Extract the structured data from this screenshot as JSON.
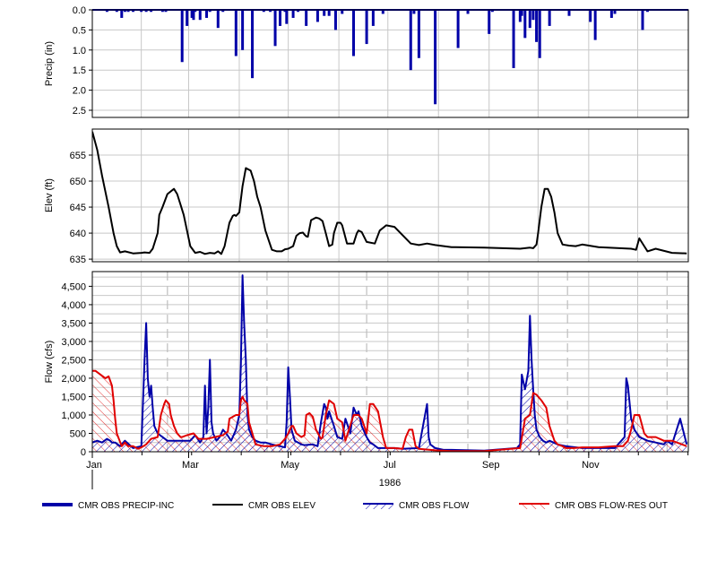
{
  "colors": {
    "precip": "#0000A8",
    "elev": "#000000",
    "flow": "#0000A8",
    "res_out": "#E00000",
    "grid": "#C8C8C8",
    "vgrid_dash": "#BEBEBE",
    "frame": "#000000"
  },
  "chart_data": [
    {
      "type": "bar",
      "panel": "precip",
      "ylabel": "Precip (in)",
      "ylim": [
        0,
        2.5
      ],
      "inverted_y": true,
      "yticks": [
        "0.0",
        "0.5",
        "1.0",
        "1.5",
        "2.0",
        "2.5"
      ],
      "grid": true,
      "series": [
        {
          "name": "CMR OBS PRECIP-INC",
          "x_day": [
            9,
            15,
            18,
            20,
            22,
            25,
            30,
            33,
            36,
            43,
            45,
            55,
            58,
            61,
            62,
            63,
            66,
            70,
            72,
            77,
            80,
            88,
            92,
            98,
            105,
            109,
            112,
            115,
            118,
            119,
            123,
            126,
            131,
            138,
            142,
            145,
            149,
            153,
            160,
            168,
            172,
            178,
            195,
            197,
            200,
            210,
            224,
            230,
            243,
            245,
            258,
            262,
            263,
            265,
            268,
            270,
            272,
            274,
            280,
            292,
            305,
            308,
            318,
            320,
            337,
            340
          ],
          "values": [
            0.05,
            0.05,
            0.2,
            0.05,
            0.05,
            0.05,
            0.05,
            0.05,
            0.05,
            0.05,
            0.05,
            1.3,
            0.4,
            0.2,
            0.25,
            0.05,
            0.25,
            0.2,
            0.05,
            0.45,
            0.05,
            1.15,
            1.0,
            1.7,
            0.05,
            0.05,
            0.9,
            0.4,
            0.05,
            0.35,
            0.2,
            0.05,
            0.4,
            0.3,
            0.15,
            0.15,
            0.5,
            0.1,
            1.15,
            0.85,
            0.4,
            0.1,
            1.5,
            0.1,
            1.2,
            2.35,
            0.95,
            0.1,
            0.6,
            0.05,
            1.45,
            0.3,
            0.15,
            0.7,
            0.45,
            0.25,
            0.8,
            1.2,
            0.4,
            0.15,
            0.3,
            0.75,
            0.2,
            0.1,
            0.5,
            0.05
          ]
        }
      ]
    },
    {
      "type": "line",
      "panel": "elev",
      "ylabel": "Elev (ft)",
      "ylim": [
        634.5,
        660
      ],
      "yticks": [
        635,
        640,
        645,
        650,
        655
      ],
      "grid": true,
      "series": [
        {
          "name": "CMR OBS ELEV",
          "x_day": [
            0,
            3,
            6,
            10,
            13,
            15,
            17,
            20,
            25,
            30,
            32,
            35,
            37,
            40,
            41,
            43,
            46,
            50,
            52,
            54,
            56,
            60,
            63,
            66,
            69,
            72,
            75,
            77,
            79,
            81,
            83,
            84,
            86,
            87,
            88,
            90,
            92,
            94,
            97,
            99,
            100,
            101,
            103,
            106,
            110,
            113,
            116,
            118,
            120,
            123,
            125,
            127,
            129,
            130,
            131,
            132,
            134,
            137,
            139,
            141,
            143,
            145,
            147,
            148,
            150,
            152,
            153,
            156,
            160,
            162,
            163,
            165,
            168,
            173,
            176,
            180,
            185,
            195,
            200,
            205,
            210,
            220,
            240,
            262,
            268,
            270,
            272,
            273,
            275,
            277,
            279,
            281,
            283,
            285,
            288,
            292,
            296,
            300,
            310,
            330,
            333,
            335,
            338,
            340,
            345,
            355,
            364
          ],
          "values": [
            659.5,
            656,
            651,
            645,
            640,
            637.5,
            636.3,
            636.5,
            636.1,
            636.2,
            636.3,
            636.2,
            637,
            640,
            643.5,
            645,
            647.5,
            648.5,
            647.5,
            645.5,
            643.5,
            637.5,
            636.2,
            636.4,
            636,
            636.2,
            636.1,
            636.5,
            636,
            637.5,
            640.5,
            642,
            643.3,
            643.5,
            643.3,
            644,
            649,
            652.5,
            652,
            650,
            648.5,
            647,
            645,
            640.5,
            636.8,
            636.5,
            636.5,
            636.9,
            637,
            637.5,
            639.5,
            640,
            640.1,
            639.7,
            639.4,
            639.3,
            642.5,
            643,
            642.8,
            642.3,
            640,
            637.5,
            637.8,
            640,
            642,
            642,
            641.5,
            638,
            638,
            640,
            640.5,
            640.2,
            638.3,
            638,
            640.5,
            641.5,
            641.2,
            638,
            637.7,
            638,
            637.7,
            637.3,
            637.2,
            637,
            637.2,
            637.1,
            637.8,
            640,
            645,
            648.5,
            648.5,
            647,
            644,
            640,
            637.8,
            637.6,
            637.5,
            637.8,
            637.3,
            637,
            636.8,
            639,
            637.5,
            636.5,
            637,
            636.2,
            636.1
          ]
        }
      ]
    },
    {
      "type": "area",
      "panel": "flow",
      "ylabel": "Flow (cfs)",
      "ylim": [
        0,
        4900
      ],
      "yticks": [
        "500",
        "1,000",
        "1,500",
        "2,000",
        "2,500",
        "3,000",
        "3,500",
        "4,000",
        "4,500"
      ],
      "xticks": [
        {
          "day": 0,
          "label": "Jan"
        },
        {
          "day": 59,
          "label": "Mar"
        },
        {
          "day": 120,
          "label": "May"
        },
        {
          "day": 181,
          "label": "Jul"
        },
        {
          "day": 243,
          "label": "Sep"
        },
        {
          "day": 304,
          "label": "Nov"
        }
      ],
      "year_label": "1986",
      "xlim": [
        0,
        365
      ],
      "grid": true,
      "series": [
        {
          "name": "CMR OBS FLOW",
          "x_day": [
            0,
            3,
            6,
            9,
            11,
            12,
            14,
            17,
            20,
            25,
            30,
            32,
            33,
            34,
            35,
            36,
            37,
            38,
            40,
            43,
            46,
            50,
            55,
            60,
            63,
            66,
            68,
            69,
            70,
            71,
            72,
            73,
            74,
            75,
            76,
            78,
            80,
            82,
            85,
            88,
            90,
            91,
            92,
            93,
            94,
            95,
            96,
            98,
            100,
            103,
            106,
            110,
            115,
            118,
            119,
            120,
            121,
            122,
            124,
            126,
            128,
            130,
            135,
            138,
            140,
            142,
            143,
            144,
            145,
            148,
            150,
            153,
            155,
            158,
            160,
            162,
            163,
            165,
            168,
            170,
            172,
            175,
            180,
            185,
            190,
            200,
            205,
            206,
            207,
            210,
            215,
            220,
            240,
            260,
            262,
            263,
            265,
            267,
            268,
            269,
            270,
            271,
            272,
            274,
            276,
            278,
            280,
            285,
            290,
            300,
            320,
            326,
            327,
            328,
            330,
            332,
            335,
            340,
            345,
            350,
            352,
            355,
            360,
            364
          ],
          "values": [
            250,
            300,
            250,
            350,
            300,
            250,
            250,
            150,
            300,
            100,
            150,
            2500,
            3500,
            2000,
            1500,
            1800,
            1200,
            700,
            500,
            400,
            300,
            300,
            300,
            300,
            450,
            250,
            400,
            1800,
            500,
            1200,
            2500,
            800,
            500,
            400,
            300,
            400,
            600,
            500,
            300,
            600,
            1000,
            2400,
            4800,
            3500,
            2500,
            1000,
            600,
            400,
            300,
            250,
            250,
            200,
            150,
            120,
            800,
            2300,
            1500,
            600,
            300,
            250,
            200,
            180,
            200,
            150,
            800,
            1300,
            1200,
            900,
            1100,
            700,
            400,
            350,
            900,
            500,
            1200,
            1000,
            1100,
            700,
            400,
            250,
            200,
            100,
            100,
            100,
            80,
            100,
            1300,
            400,
            200,
            100,
            50,
            50,
            30,
            100,
            200,
            2100,
            1700,
            2200,
            3700,
            2500,
            1700,
            1000,
            600,
            400,
            300,
            250,
            300,
            200,
            150,
            100,
            100,
            400,
            2000,
            1800,
            900,
            600,
            400,
            300,
            250,
            200,
            300,
            200,
            900,
            200
          ]
        },
        {
          "name": "CMR OBS FLOW-RES OUT",
          "x_day": [
            0,
            2,
            5,
            8,
            10,
            12,
            13,
            14,
            15,
            18,
            20,
            22,
            25,
            28,
            30,
            33,
            36,
            40,
            42,
            44,
            45,
            47,
            48,
            50,
            52,
            54,
            55,
            58,
            62,
            65,
            70,
            75,
            80,
            83,
            84,
            86,
            88,
            90,
            91,
            92,
            93,
            95,
            96,
            100,
            105,
            110,
            115,
            118,
            120,
            122,
            123,
            125,
            128,
            130,
            131,
            133,
            135,
            137,
            140,
            141,
            143,
            145,
            148,
            150,
            153,
            155,
            160,
            163,
            165,
            168,
            170,
            172,
            175,
            178,
            180,
            185,
            190,
            192,
            194,
            196,
            198,
            200,
            210,
            220,
            240,
            262,
            265,
            268,
            270,
            272,
            275,
            278,
            280,
            283,
            285,
            288,
            290,
            295,
            300,
            310,
            320,
            325,
            328,
            330,
            332,
            335,
            338,
            340,
            345,
            350,
            355,
            364
          ],
          "values": [
            2200,
            2200,
            2100,
            2000,
            2050,
            1800,
            1400,
            900,
            500,
            150,
            250,
            150,
            150,
            80,
            120,
            200,
            350,
            400,
            1000,
            1300,
            1400,
            1300,
            1000,
            700,
            500,
            400,
            400,
            450,
            500,
            350,
            350,
            400,
            450,
            550,
            900,
            950,
            1000,
            1000,
            1400,
            1500,
            1400,
            1300,
            800,
            200,
            150,
            150,
            200,
            350,
            500,
            700,
            700,
            500,
            400,
            450,
            1000,
            1050,
            950,
            600,
            350,
            400,
            1000,
            1400,
            1300,
            900,
            800,
            300,
            1000,
            1000,
            900,
            500,
            1300,
            1300,
            1100,
            400,
            100,
            100,
            80,
            400,
            600,
            600,
            150,
            80,
            40,
            20,
            20,
            100,
            900,
            1000,
            1600,
            1550,
            1400,
            1200,
            700,
            300,
            200,
            150,
            100,
            100,
            120,
            120,
            150,
            150,
            300,
            600,
            1000,
            1000,
            500,
            400,
            400,
            300,
            300,
            150
          ]
        }
      ]
    }
  ],
  "legend": [
    {
      "label": "CMR OBS PRECIP-INC",
      "style": "precip"
    },
    {
      "label": "CMR OBS ELEV",
      "style": "elev"
    },
    {
      "label": "CMR OBS FLOW",
      "style": "flow"
    },
    {
      "label": "CMR OBS FLOW-RES OUT",
      "style": "res_out"
    }
  ]
}
